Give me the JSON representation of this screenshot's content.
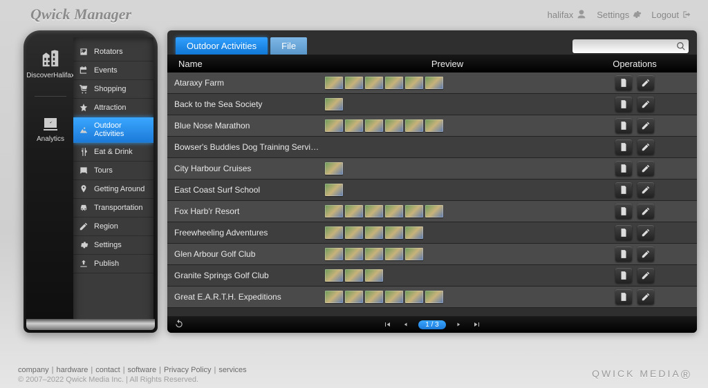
{
  "app": {
    "title": "Qwick Manager"
  },
  "header": {
    "user": "halifax",
    "settings": "Settings",
    "logout": "Logout"
  },
  "rail": {
    "items": [
      {
        "label": "DiscoverHalifax",
        "icon": "buildings"
      },
      {
        "label": "Analytics",
        "icon": "analytics"
      }
    ]
  },
  "sidebar": {
    "items": [
      {
        "label": "Rotators",
        "icon": "image"
      },
      {
        "label": "Events",
        "icon": "calendar"
      },
      {
        "label": "Shopping",
        "icon": "cart"
      },
      {
        "label": "Attraction",
        "icon": "star"
      },
      {
        "label": "Outdoor Activities",
        "icon": "outdoor",
        "active": true
      },
      {
        "label": "Eat & Drink",
        "icon": "utensils"
      },
      {
        "label": "Tours",
        "icon": "bus"
      },
      {
        "label": "Getting Around",
        "icon": "pin"
      },
      {
        "label": "Transportation",
        "icon": "car"
      },
      {
        "label": "Region",
        "icon": "pencil"
      },
      {
        "label": "Settings",
        "icon": "gear"
      },
      {
        "label": "Publish",
        "icon": "upload"
      }
    ]
  },
  "tabs": [
    {
      "label": "Outdoor Activities",
      "active": true
    },
    {
      "label": "File",
      "active": false
    }
  ],
  "search": {
    "placeholder": ""
  },
  "columns": {
    "name": "Name",
    "preview": "Preview",
    "operations": "Operations"
  },
  "rows": [
    {
      "name": "Ataraxy Farm",
      "thumbs": 6
    },
    {
      "name": "Back to the Sea Society",
      "thumbs": 1
    },
    {
      "name": "Blue Nose Marathon",
      "thumbs": 6
    },
    {
      "name": "Bowser's Buddies Dog Training Services",
      "thumbs": 0
    },
    {
      "name": "City Harbour Cruises",
      "thumbs": 1
    },
    {
      "name": "East Coast Surf School",
      "thumbs": 1
    },
    {
      "name": "Fox Harb'r Resort",
      "thumbs": 6
    },
    {
      "name": "Freewheeling Adventures",
      "thumbs": 5
    },
    {
      "name": "Glen Arbour Golf Club",
      "thumbs": 5
    },
    {
      "name": "Granite Springs Golf Club",
      "thumbs": 3
    },
    {
      "name": "Great E.A.R.T.H. Expeditions",
      "thumbs": 6
    }
  ],
  "pager": {
    "page": "1 / 3"
  },
  "footer": {
    "links": [
      "company",
      "hardware",
      "contact",
      "software",
      "Privacy Policy",
      "services"
    ],
    "copyright": "© 2007–2022 Qwick Media Inc. | All Rights Reserved.",
    "brand": "QWICK MEDIA"
  }
}
